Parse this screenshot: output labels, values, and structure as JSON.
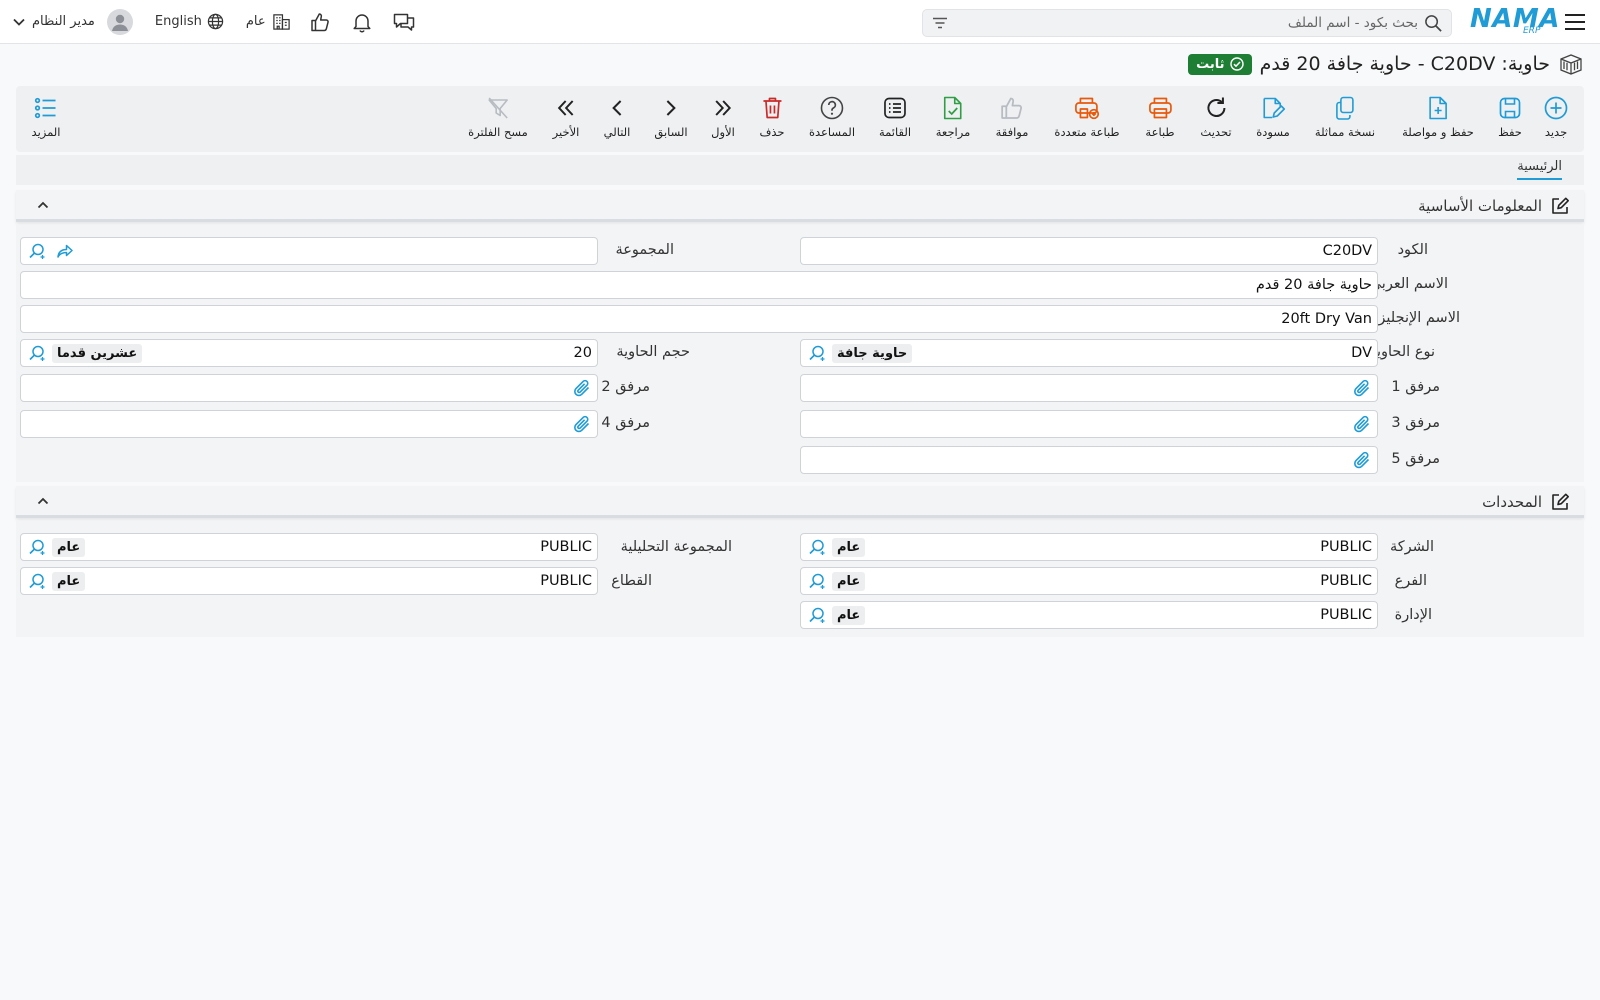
{
  "header": {
    "search_placeholder": "بحث بكود - اسم الملف",
    "logo_text": "NAMA",
    "logo_sub": "ERP",
    "user_name": "مدير النظام",
    "language": "English",
    "company": "عام"
  },
  "title": {
    "text": "حاوية: C20DV - حاوية جافة 20 قدم",
    "status": "ثابت"
  },
  "toolbar": {
    "new": "جديد",
    "save": "حفظ",
    "save_continue": "حفظ و مواصلة",
    "duplicate": "نسخة مماثلة",
    "draft": "مسودة",
    "refresh": "تحديث",
    "print": "طباعة",
    "multi_print": "طباعة متعددة",
    "approve": "موافقة",
    "review": "مراجعة",
    "list": "القائمة",
    "help": "المساعدة",
    "delete": "حذف",
    "first": "الأول",
    "previous": "السابق",
    "next": "التالي",
    "last": "الأخير",
    "clear_filter": "مسح الفلترة",
    "more": "المزيد"
  },
  "tabs": {
    "main": "الرئيسية"
  },
  "sections": {
    "basic": "المعلومات الأساسية",
    "dimensions": "المحددات"
  },
  "fields": {
    "code": {
      "label": "الكود",
      "value": "C20DV"
    },
    "group": {
      "label": "المجموعة",
      "value": ""
    },
    "arabic_name": {
      "label": "الاسم العربي",
      "value": "حاوية جافة 20 قدم"
    },
    "english_name": {
      "label": "الاسم الإنجليزي",
      "value": "20ft Dry Van"
    },
    "container_type": {
      "label": "نوع الحاوية",
      "code": "DV",
      "name": "حاوية جافة"
    },
    "container_size": {
      "label": "حجم الحاوية",
      "code": "20",
      "name": "عشرين قدما"
    },
    "attachment1": {
      "label": "مرفق 1"
    },
    "attachment2": {
      "label": "مرفق 2"
    },
    "attachment3": {
      "label": "مرفق 3"
    },
    "attachment4": {
      "label": "مرفق 4"
    },
    "attachment5": {
      "label": "مرفق 5"
    },
    "company": {
      "label": "الشركة",
      "code": "PUBLIC",
      "name": "عام"
    },
    "analytic_group": {
      "label": "المجموعة التحليلية",
      "code": "PUBLIC",
      "name": "عام"
    },
    "branch": {
      "label": "الفرع",
      "code": "PUBLIC",
      "name": "عام"
    },
    "sector": {
      "label": "القطاع",
      "code": "PUBLIC",
      "name": "عام"
    },
    "department": {
      "label": "الإدارة",
      "code": "PUBLIC",
      "name": "عام"
    }
  },
  "colors": {
    "accent": "#1f9bd6",
    "status_green": "#1e7e34",
    "print_orange": "#e8590c",
    "delete_red": "#c92a2a",
    "review_green": "#2f9e44"
  }
}
